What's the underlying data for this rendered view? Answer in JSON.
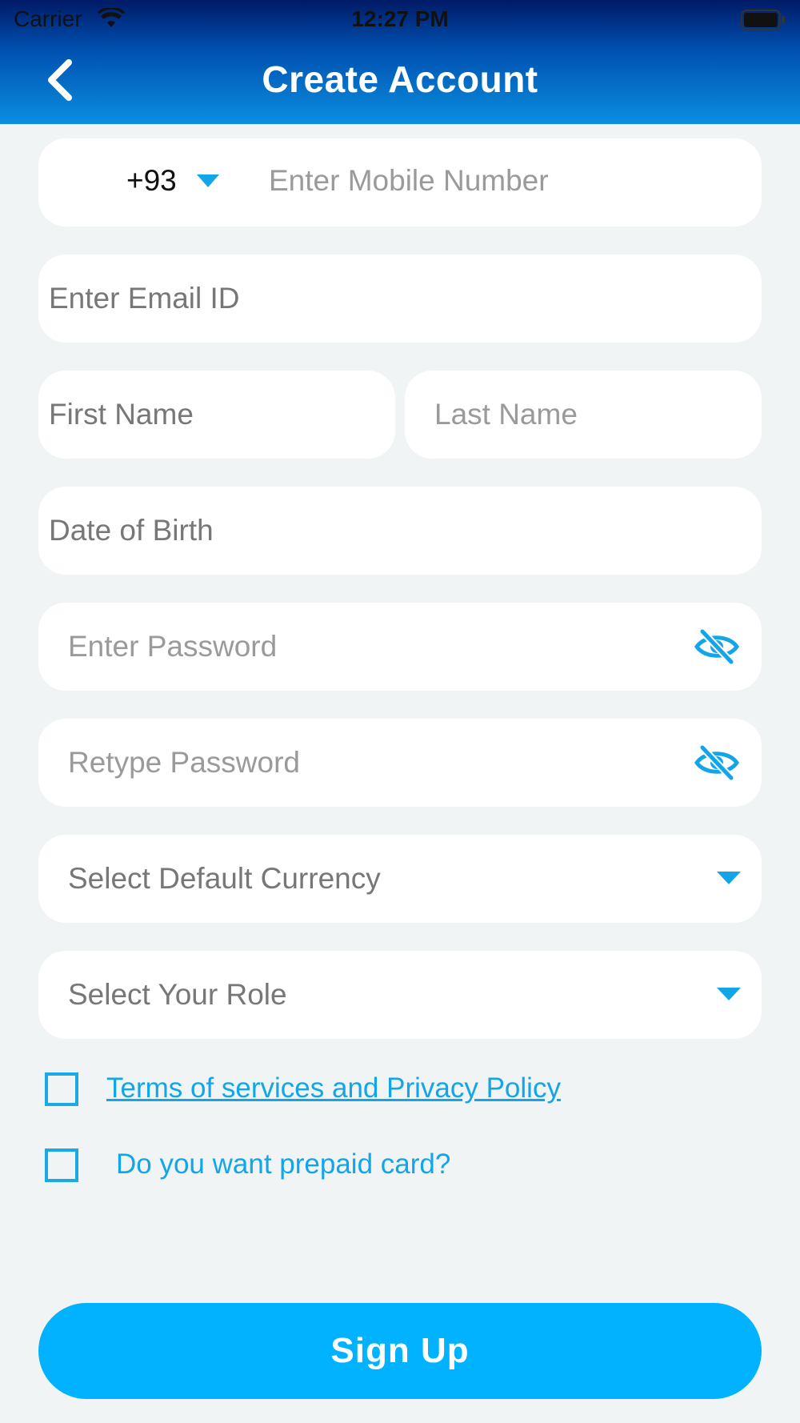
{
  "status_bar": {
    "carrier": "Carrier",
    "time": "12:27 PM"
  },
  "header": {
    "title": "Create Account"
  },
  "form": {
    "country_code": "+93",
    "mobile_placeholder": "Enter Mobile Number",
    "email_placeholder": "Enter Email ID",
    "first_name_placeholder": "First Name",
    "last_name_placeholder": "Last Name",
    "dob_placeholder": "Date of Birth",
    "password_placeholder": "Enter Password",
    "retype_password_placeholder": "Retype Password",
    "currency_placeholder": "Select Default Currency",
    "role_placeholder": "Select Your Role",
    "terms_label": "Terms of services and Privacy Policy",
    "prepaid_label": "Do you want prepaid card?",
    "terms_checked": false,
    "prepaid_checked": false
  },
  "actions": {
    "signup_label": "Sign Up"
  },
  "colors": {
    "accent": "#00b2ff",
    "link": "#12a6e8",
    "background": "#f0f4f5",
    "header_top": "#001a66",
    "header_bottom": "#0a8fe0"
  },
  "icons": {
    "back": "chevron-left-icon",
    "eye": "eye-off-icon",
    "dropdown": "caret-down-icon"
  }
}
